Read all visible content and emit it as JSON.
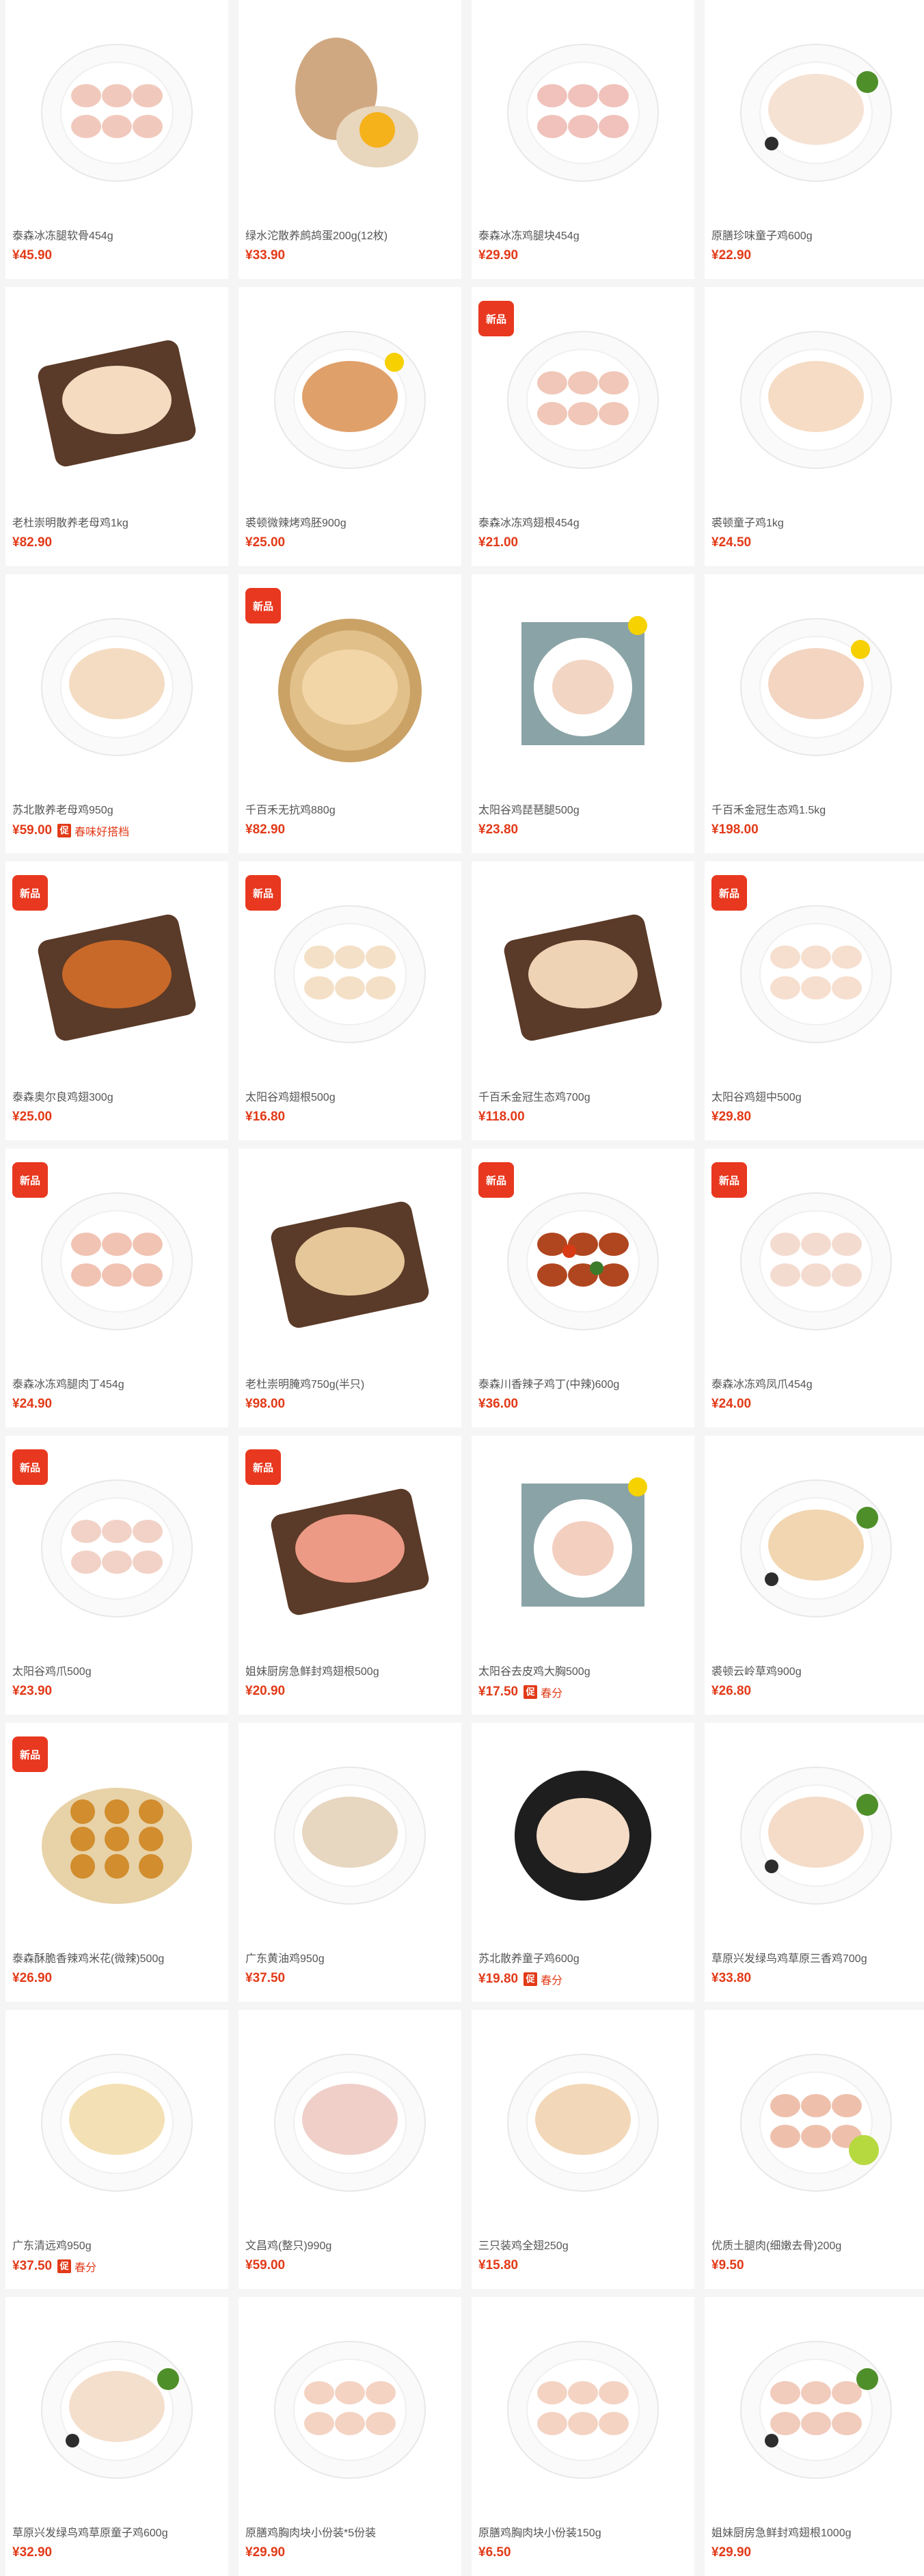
{
  "products": [
    {
      "name": "泰森冰冻腿软骨454g",
      "price": "¥45.90",
      "new_label": "",
      "promo": "",
      "promo_text": "",
      "icon": "bowl-diced-cartilage",
      "food": "#f1c9bc"
    },
    {
      "name": "绿水沱散养鹧鸪蛋200g(12枚)",
      "price": "¥33.90",
      "new_label": "",
      "promo": "",
      "promo_text": "",
      "icon": "egg-yolk",
      "food": "#cfa881"
    },
    {
      "name": "泰森冰冻鸡腿块454g",
      "price": "¥29.90",
      "new_label": "",
      "promo": "",
      "promo_text": "",
      "icon": "plate-leg-pieces",
      "food": "#f0c2bb"
    },
    {
      "name": "原膳珍味童子鸡600g",
      "price": "¥22.90",
      "new_label": "",
      "promo": "",
      "promo_text": "",
      "icon": "plate-whole-chicken-veg",
      "food": "#f6e2d3"
    },
    {
      "name": "老杜崇明散养老母鸡1kg",
      "price": "¥82.90",
      "new_label": "",
      "promo": "",
      "promo_text": "",
      "icon": "board-whole-chicken",
      "food": "#f5dcc1"
    },
    {
      "name": "裘顿微辣烤鸡胚900g",
      "price": "¥25.00",
      "new_label": "",
      "promo": "",
      "promo_text": "",
      "icon": "plate-roast-chicken",
      "food": "#e0a06a"
    },
    {
      "name": "泰森冰冻鸡翅根454g",
      "price": "¥21.00",
      "new_label": "新品",
      "promo": "",
      "promo_text": "",
      "icon": "plate-drumettes",
      "food": "#f0c7b8"
    },
    {
      "name": "裘顿童子鸡1kg",
      "price": "¥24.50",
      "new_label": "",
      "promo": "",
      "promo_text": "",
      "icon": "plate-whole-chicken",
      "food": "#f6dcc5"
    },
    {
      "name": "苏北散养老母鸡950g",
      "price": "¥59.00",
      "new_label": "",
      "promo": "促",
      "promo_text": "春味好搭档",
      "icon": "plate-whole-chicken",
      "food": "#f4dcc2"
    },
    {
      "name": "千百禾无抗鸡880g",
      "price": "¥82.90",
      "new_label": "新品",
      "promo": "",
      "promo_text": "",
      "icon": "tray-whole-chicken",
      "food": "#f2d6a8"
    },
    {
      "name": "太阳谷鸡琵琶腿500g",
      "price": "¥23.80",
      "new_label": "",
      "promo": "",
      "promo_text": "",
      "icon": "mat-drumsticks",
      "food": "#f2d5c3"
    },
    {
      "name": "千百禾金冠生态鸡1.5kg",
      "price": "¥198.00",
      "new_label": "",
      "promo": "",
      "promo_text": "",
      "icon": "plate-whole-chicken-lemon",
      "food": "#f3d5c1"
    },
    {
      "name": "泰森奥尔良鸡翅300g",
      "price": "¥25.00",
      "new_label": "新品",
      "promo": "",
      "promo_text": "",
      "icon": "board-fried-wings",
      "food": "#c8692a"
    },
    {
      "name": "太阳谷鸡翅根500g",
      "price": "¥16.80",
      "new_label": "新品",
      "promo": "",
      "promo_text": "",
      "icon": "plate-drumettes",
      "food": "#f4e0c7"
    },
    {
      "name": "千百禾金冠生态鸡700g",
      "price": "¥118.00",
      "new_label": "",
      "promo": "",
      "promo_text": "",
      "icon": "board-half-chicken",
      "food": "#efd3b5"
    },
    {
      "name": "太阳谷鸡翅中500g",
      "price": "¥29.80",
      "new_label": "新品",
      "promo": "",
      "promo_text": "",
      "icon": "plate-wing-mids",
      "food": "#f6dfcf"
    },
    {
      "name": "泰森冰冻鸡腿肉丁454g",
      "price": "¥24.90",
      "new_label": "新品",
      "promo": "",
      "promo_text": "",
      "icon": "plate-diced-chicken",
      "food": "#f1c3b3"
    },
    {
      "name": "老杜崇明腌鸡750g(半只)",
      "price": "¥98.00",
      "new_label": "",
      "promo": "",
      "promo_text": "",
      "icon": "board-whole-chicken",
      "food": "#e6c79a"
    },
    {
      "name": "泰森川香辣子鸡丁(中辣)600g",
      "price": "¥36.00",
      "new_label": "新品",
      "promo": "",
      "promo_text": "",
      "icon": "bowl-spicy-chicken",
      "food": "#b0461f"
    },
    {
      "name": "泰森冰冻鸡凤爪454g",
      "price": "¥24.00",
      "new_label": "新品",
      "promo": "",
      "promo_text": "",
      "icon": "plate-chicken-feet",
      "food": "#f4dbd0"
    },
    {
      "name": "太阳谷鸡爪500g",
      "price": "¥23.90",
      "new_label": "新品",
      "promo": "",
      "promo_text": "",
      "icon": "plate-chicken-feet",
      "food": "#f2d2c7"
    },
    {
      "name": "姐妹厨房急鲜封鸡翅根500g",
      "price": "¥20.90",
      "new_label": "新品",
      "promo": "",
      "promo_text": "",
      "icon": "board-drumettes",
      "food": "#ec9a85"
    },
    {
      "name": "太阳谷去皮鸡大胸500g",
      "price": "¥17.50",
      "new_label": "",
      "promo": "促",
      "promo_text": "春分",
      "icon": "mat-breast",
      "food": "#f3cfc0"
    },
    {
      "name": "裘顿云岭草鸡900g",
      "price": "¥26.80",
      "new_label": "",
      "promo": "",
      "promo_text": "",
      "icon": "plate-whole-chicken-veg",
      "food": "#f1d6b1"
    },
    {
      "name": "泰森酥脆香辣鸡米花(微辣)500g",
      "price": "¥26.90",
      "new_label": "新品",
      "promo": "",
      "promo_text": "",
      "icon": "basket-popcorn-chicken",
      "food": "#d18d2e"
    },
    {
      "name": "广东黄油鸡950g",
      "price": "¥37.50",
      "new_label": "",
      "promo": "",
      "promo_text": "",
      "icon": "plate-whole-chicken",
      "food": "#e7d6c0"
    },
    {
      "name": "苏北散养童子鸡600g",
      "price": "¥19.80",
      "new_label": "",
      "promo": "促",
      "promo_text": "春分",
      "icon": "dark-plate-chicken",
      "food": "#f4dcc6"
    },
    {
      "name": "草原兴发绿鸟鸡草原三香鸡700g",
      "price": "¥33.80",
      "new_label": "",
      "promo": "",
      "promo_text": "",
      "icon": "plate-whole-chicken-veg",
      "food": "#f4dcc9"
    },
    {
      "name": "广东清远鸡950g",
      "price": "¥37.50",
      "new_label": "",
      "promo": "促",
      "promo_text": "春分",
      "icon": "plate-whole-chicken",
      "food": "#f3e0b4"
    },
    {
      "name": "文昌鸡(整只)990g",
      "price": "¥59.00",
      "new_label": "",
      "promo": "",
      "promo_text": "",
      "icon": "plate-whole-chicken",
      "food": "#f0cfc9"
    },
    {
      "name": "三只装鸡全翅250g",
      "price": "¥15.80",
      "new_label": "",
      "promo": "",
      "promo_text": "",
      "icon": "plate-whole-wings",
      "food": "#f2d8b8"
    },
    {
      "name": "优质土腿肉(细嫩去骨)200g",
      "price": "¥9.50",
      "new_label": "",
      "promo": "",
      "promo_text": "",
      "icon": "plate-thigh-lime",
      "food": "#eec0ac"
    },
    {
      "name": "草原兴发绿鸟鸡草原童子鸡600g",
      "price": "¥32.90",
      "new_label": "",
      "promo": "",
      "promo_text": "",
      "icon": "plate-whole-chicken-veg",
      "food": "#f4dfcd"
    },
    {
      "name": "原膳鸡胸肉块小份装*5份装",
      "price": "¥29.90",
      "new_label": "",
      "promo": "",
      "promo_text": "",
      "icon": "plate-breast-chunks",
      "food": "#f4d3c3"
    },
    {
      "name": "原膳鸡胸肉块小份装150g",
      "price": "¥6.50",
      "new_label": "",
      "promo": "",
      "promo_text": "",
      "icon": "plate-breast-chunks",
      "food": "#f4d3c3"
    },
    {
      "name": "姐妹厨房急鲜封鸡翅根1000g",
      "price": "¥29.90",
      "new_label": "",
      "promo": "",
      "promo_text": "",
      "icon": "plate-drumettes-veg",
      "food": "#f1cbbb"
    }
  ]
}
